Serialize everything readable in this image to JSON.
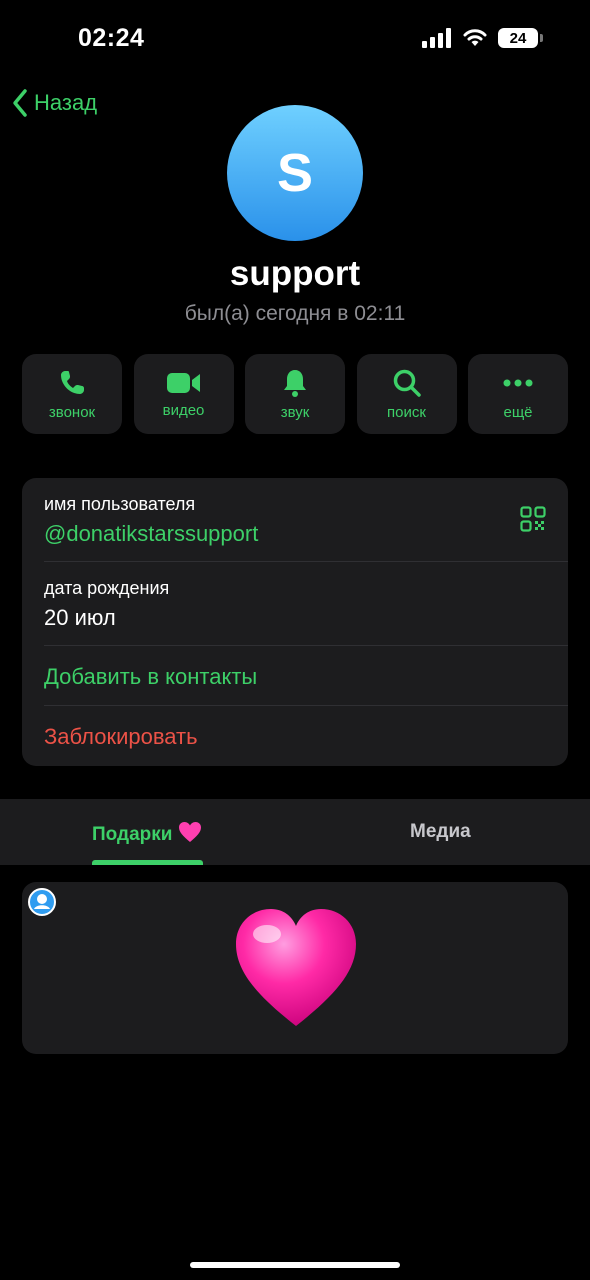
{
  "status_bar": {
    "time": "02:24",
    "battery": "24"
  },
  "nav": {
    "back_label": "Назад"
  },
  "profile": {
    "avatar_letter": "S",
    "name": "support",
    "last_seen": "был(а) сегодня в 02:11"
  },
  "actions": [
    {
      "label": "звонок",
      "icon": "phone-icon"
    },
    {
      "label": "видео",
      "icon": "video-camera-icon"
    },
    {
      "label": "звук",
      "icon": "bell-icon"
    },
    {
      "label": "поиск",
      "icon": "search-icon"
    },
    {
      "label": "ещё",
      "icon": "more-dots-icon"
    }
  ],
  "info": {
    "username_label": "имя пользователя",
    "username_value": "@donatikstarssupport",
    "birthday_label": "дата рождения",
    "birthday_value": "20 июл",
    "add_contact": "Добавить в контакты",
    "block": "Заблокировать"
  },
  "tabs": [
    {
      "label": "Подарки",
      "emoji": "💗",
      "active": true
    },
    {
      "label": "Медиа",
      "active": false
    }
  ],
  "gifts": {
    "items": [
      {
        "emoji": "heart",
        "color": "#ff2aa6"
      }
    ]
  },
  "colors": {
    "accent": "#3dd068",
    "danger": "#ec5247",
    "avatar": "#3aa6f5"
  }
}
